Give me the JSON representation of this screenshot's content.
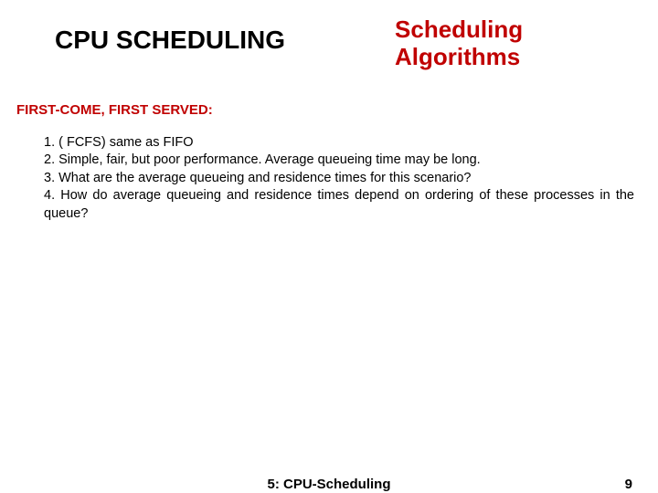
{
  "header": {
    "title_left": "CPU SCHEDULING",
    "title_right_line1": "Scheduling",
    "title_right_line2": "Algorithms"
  },
  "section": {
    "heading": "FIRST-COME, FIRST SERVED:"
  },
  "list": {
    "item1": "1. ( FCFS) same as FIFO",
    "item2": "2. Simple, fair, but poor performance.   Average queueing time may be long.",
    "item3": "3. What are the average queueing and residence times for this scenario?",
    "item4": "4. How do average queueing and residence times depend on ordering of these processes in the queue?"
  },
  "footer": {
    "center": "5: CPU-Scheduling",
    "page": "9"
  }
}
